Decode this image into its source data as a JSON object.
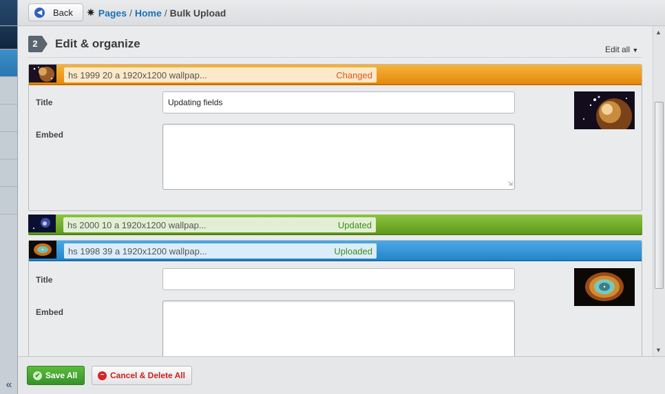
{
  "header": {
    "back_label": "Back",
    "breadcrumb": [
      "Pages",
      "Home",
      "Bulk Upload"
    ],
    "separator": "/"
  },
  "rail": {
    "collapse_glyph": "«"
  },
  "section": {
    "step_number": "2",
    "title": "Edit & organize",
    "edit_all_label": "Edit all"
  },
  "items": [
    {
      "name": "hs 1999 20 a 1920x1200 wallpap...",
      "status": "Changed",
      "state": "orange",
      "expanded": true,
      "title_label": "Title",
      "title_value": "Updating fields",
      "embed_label": "Embed",
      "embed_value": ""
    },
    {
      "name": "hs 2000 10 a 1920x1200 wallpap...",
      "status": "Updated",
      "state": "green",
      "expanded": false
    },
    {
      "name": "hs 1998 39 a 1920x1200 wallpap...",
      "status": "Uploaded",
      "state": "blue",
      "expanded": true,
      "title_label": "Title",
      "title_value": "",
      "embed_label": "Embed",
      "embed_value": ""
    }
  ],
  "footer": {
    "save_label": "Save All",
    "cancel_label": "Cancel & Delete All"
  },
  "colors": {
    "changed": "#e48a0c",
    "updated": "#5f9a1c",
    "uploaded": "#2485c9",
    "link": "#1a72b5",
    "save": "#35922a",
    "cancel": "#cc1f1f"
  },
  "icons": [
    "back-arrow-icon",
    "puzzle-icon",
    "chevron-down-icon",
    "checkmark-icon",
    "no-entry-icon",
    "collapse-icon"
  ]
}
